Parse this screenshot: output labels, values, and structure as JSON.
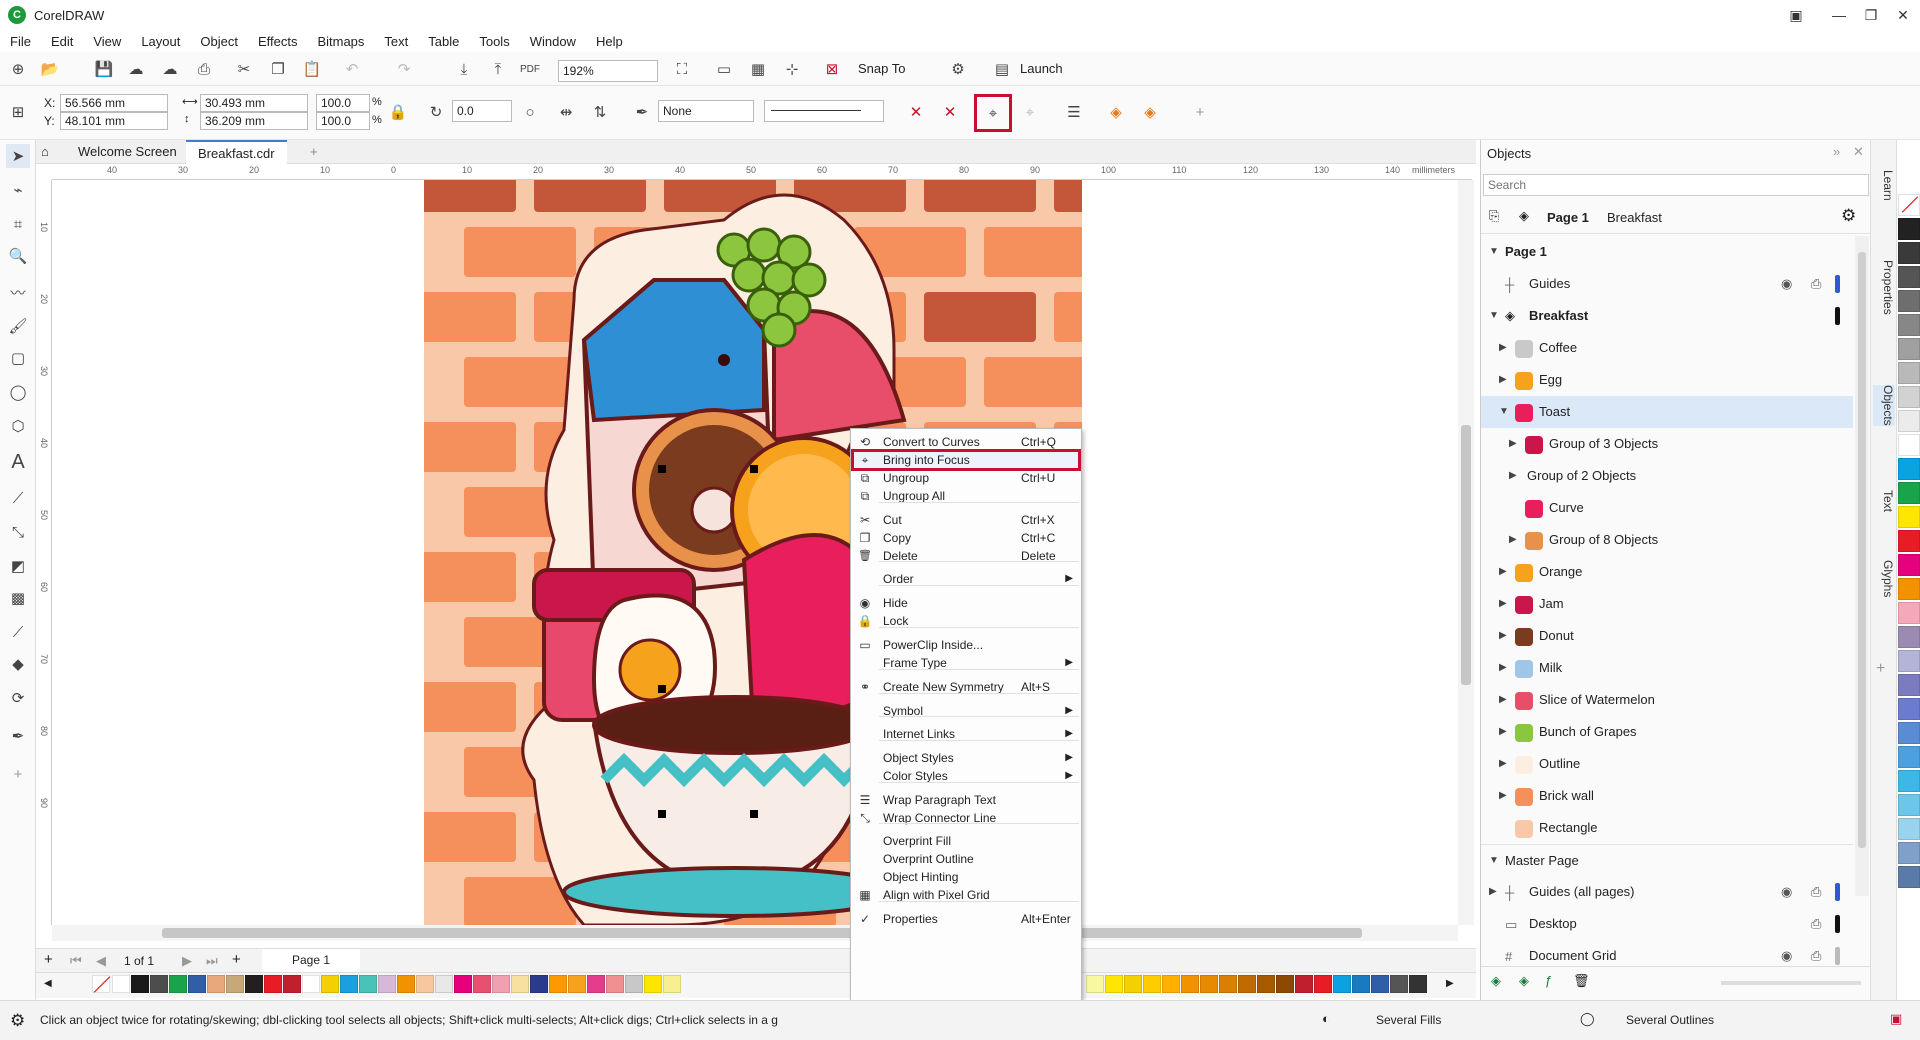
{
  "app": {
    "title": "CorelDRAW"
  },
  "menu": [
    "File",
    "Edit",
    "View",
    "Layout",
    "Object",
    "Effects",
    "Bitmaps",
    "Text",
    "Table",
    "Tools",
    "Window",
    "Help"
  ],
  "std_toolbar": {
    "zoom": "192%",
    "snap_to": "Snap To",
    "launch": "Launch"
  },
  "prop_bar": {
    "x_label": "X:",
    "x": "56.566 mm",
    "y_label": "Y:",
    "y": "48.101 mm",
    "w": "30.493 mm",
    "h": "36.209 mm",
    "sw": "100.0",
    "sh": "100.0",
    "pct1": "%",
    "pct2": "%",
    "rotation": "0.0",
    "fill": "None"
  },
  "tabs": {
    "welcome": "Welcome Screen",
    "doc": "Breakfast.cdr"
  },
  "ruler": {
    "units": "millimeters",
    "h_ticks": [
      "40",
      "30",
      "20",
      "10",
      "0",
      "10",
      "20",
      "30",
      "40",
      "50",
      "60",
      "70",
      "80",
      "90",
      "100",
      "110",
      "120",
      "130",
      "140"
    ],
    "v_ticks": [
      "10",
      "20",
      "30",
      "40",
      "50",
      "60",
      "70",
      "80",
      "90"
    ]
  },
  "context_menu": {
    "items": [
      {
        "label": "Convert to Curves",
        "shortcut": "Ctrl+Q",
        "icon": "convert-curves-icon"
      },
      {
        "label": "Bring into Focus",
        "shortcut": "",
        "icon": "bring-focus-icon",
        "highlighted": true
      },
      {
        "label": "Ungroup",
        "shortcut": "Ctrl+U",
        "icon": "ungroup-icon"
      },
      {
        "label": "Ungroup All",
        "shortcut": "",
        "icon": "ungroup-all-icon"
      },
      {
        "label": "Cut",
        "shortcut": "Ctrl+X",
        "icon": "cut-icon"
      },
      {
        "label": "Copy",
        "shortcut": "Ctrl+C",
        "icon": "copy-icon"
      },
      {
        "label": "Delete",
        "shortcut": "Delete",
        "icon": "trash-icon"
      },
      {
        "label": "Order",
        "submenu": true
      },
      {
        "label": "Hide",
        "icon": "eye-icon"
      },
      {
        "label": "Lock",
        "icon": "lock-icon"
      },
      {
        "label": "PowerClip Inside...",
        "icon": "powerclip-icon"
      },
      {
        "label": "Frame Type",
        "submenu": true
      },
      {
        "label": "Create New Symmetry",
        "shortcut": "Alt+S",
        "icon": "symmetry-icon"
      },
      {
        "label": "Symbol",
        "submenu": true
      },
      {
        "label": "Internet Links",
        "submenu": true
      },
      {
        "label": "Object Styles",
        "submenu": true
      },
      {
        "label": "Color Styles",
        "submenu": true
      },
      {
        "label": "Wrap Paragraph Text",
        "icon": "wrap-text-icon"
      },
      {
        "label": "Wrap Connector Line",
        "icon": "wrap-connector-icon"
      },
      {
        "label": "Overprint Fill"
      },
      {
        "label": "Overprint Outline"
      },
      {
        "label": "Object Hinting"
      },
      {
        "label": "Align with Pixel Grid",
        "icon": "pixel-grid-icon"
      },
      {
        "label": "Properties",
        "shortcut": "Alt+Enter",
        "icon": "check-icon"
      }
    ]
  },
  "objects_panel": {
    "title": "Objects",
    "search_placeholder": "Search",
    "page_label": "Page 1",
    "doc_label": "Breakfast",
    "page_node": "Page 1",
    "rows": [
      {
        "name": "Guides"
      },
      {
        "name": "Breakfast"
      },
      {
        "name": "Coffee"
      },
      {
        "name": "Egg"
      },
      {
        "name": "Toast"
      },
      {
        "name": "Group of 3 Objects"
      },
      {
        "name": "Group of 2 Objects"
      },
      {
        "name": "Curve"
      },
      {
        "name": "Group of 8 Objects"
      },
      {
        "name": "Orange"
      },
      {
        "name": "Jam"
      },
      {
        "name": "Donut"
      },
      {
        "name": "Milk"
      },
      {
        "name": "Slice of Watermelon"
      },
      {
        "name": "Bunch of Grapes"
      },
      {
        "name": "Outline"
      },
      {
        "name": "Brick wall"
      },
      {
        "name": "Rectangle"
      },
      {
        "name": "Master Page"
      },
      {
        "name": "Guides (all pages)"
      },
      {
        "name": "Desktop"
      },
      {
        "name": "Document Grid"
      }
    ]
  },
  "side_tabs": [
    "Learn",
    "Properties",
    "Objects",
    "Text",
    "Glyphs"
  ],
  "page_nav": {
    "counter": "1 of 1",
    "page_tab": "Page 1"
  },
  "status": {
    "hint": "Click an object twice for rotating/skewing; dbl-clicking tool selects all objects; Shift+click multi-selects; Alt+click digs; Ctrl+click selects in a g",
    "fills": "Several Fills",
    "outlines": "Several Outlines"
  },
  "colors": {
    "accent_red": "#c8102e",
    "brick": "#f58f5c",
    "brick_dark": "#c4573a",
    "wall": "#f9c8a8",
    "selected_row": "#dbe8f7"
  }
}
